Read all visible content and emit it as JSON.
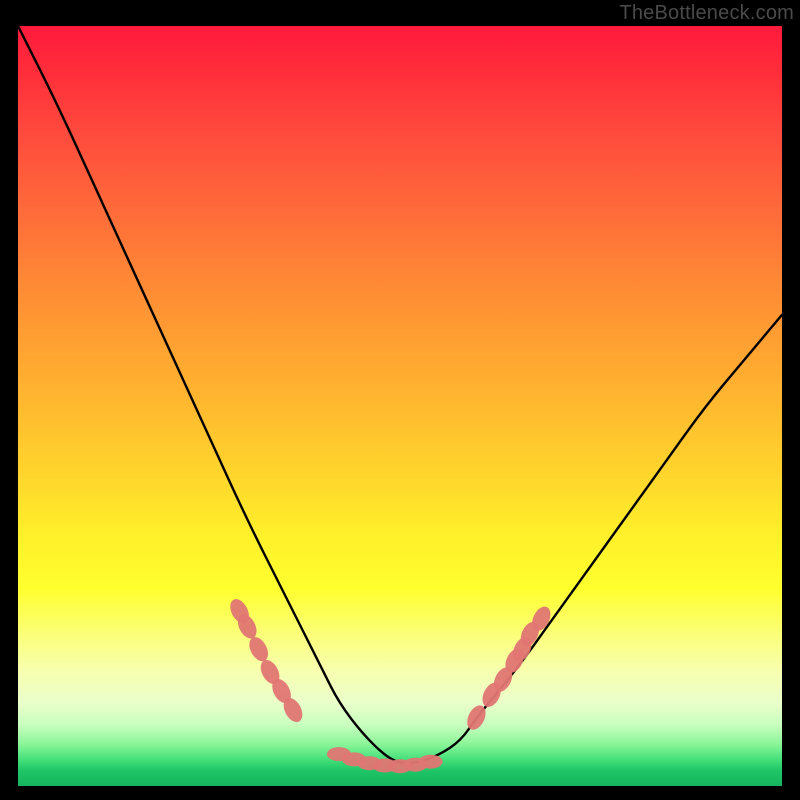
{
  "watermark": "TheBottleneck.com",
  "colors": {
    "curve": "#000000",
    "marker_fill": "#e07673",
    "marker_stroke": "#c75a57",
    "gradient_top": "#ff1a3c",
    "gradient_bottom": "#15b45d"
  },
  "chart_data": {
    "type": "line",
    "title": "",
    "xlabel": "",
    "ylabel": "",
    "xlim": [
      0,
      100
    ],
    "ylim": [
      0,
      100
    ],
    "curve": {
      "x": [
        0,
        5,
        10,
        15,
        20,
        25,
        30,
        35,
        40,
        42,
        45,
        48,
        50,
        52,
        55,
        58,
        60,
        65,
        70,
        75,
        80,
        85,
        90,
        95,
        100
      ],
      "y_pct": [
        100,
        90,
        79,
        68,
        57,
        46,
        35,
        25,
        15,
        11,
        7,
        4,
        3,
        3,
        4,
        6,
        9,
        15,
        22,
        29,
        36,
        43,
        50,
        56,
        62
      ]
    },
    "markers_left": [
      {
        "x": 29,
        "y_pct": 23
      },
      {
        "x": 30,
        "y_pct": 21
      },
      {
        "x": 31.5,
        "y_pct": 18
      },
      {
        "x": 33,
        "y_pct": 15
      },
      {
        "x": 34.5,
        "y_pct": 12.5
      },
      {
        "x": 36,
        "y_pct": 10
      }
    ],
    "markers_bottom": [
      {
        "x": 42,
        "y_pct": 4.2
      },
      {
        "x": 44,
        "y_pct": 3.5
      },
      {
        "x": 46,
        "y_pct": 3.0
      },
      {
        "x": 48,
        "y_pct": 2.7
      },
      {
        "x": 50,
        "y_pct": 2.6
      },
      {
        "x": 52,
        "y_pct": 2.8
      },
      {
        "x": 54,
        "y_pct": 3.2
      }
    ],
    "markers_right": [
      {
        "x": 60,
        "y_pct": 9
      },
      {
        "x": 62,
        "y_pct": 12
      },
      {
        "x": 63.5,
        "y_pct": 14
      },
      {
        "x": 65,
        "y_pct": 16.5
      },
      {
        "x": 66,
        "y_pct": 18
      },
      {
        "x": 67,
        "y_pct": 20
      },
      {
        "x": 68.5,
        "y_pct": 22
      }
    ]
  }
}
